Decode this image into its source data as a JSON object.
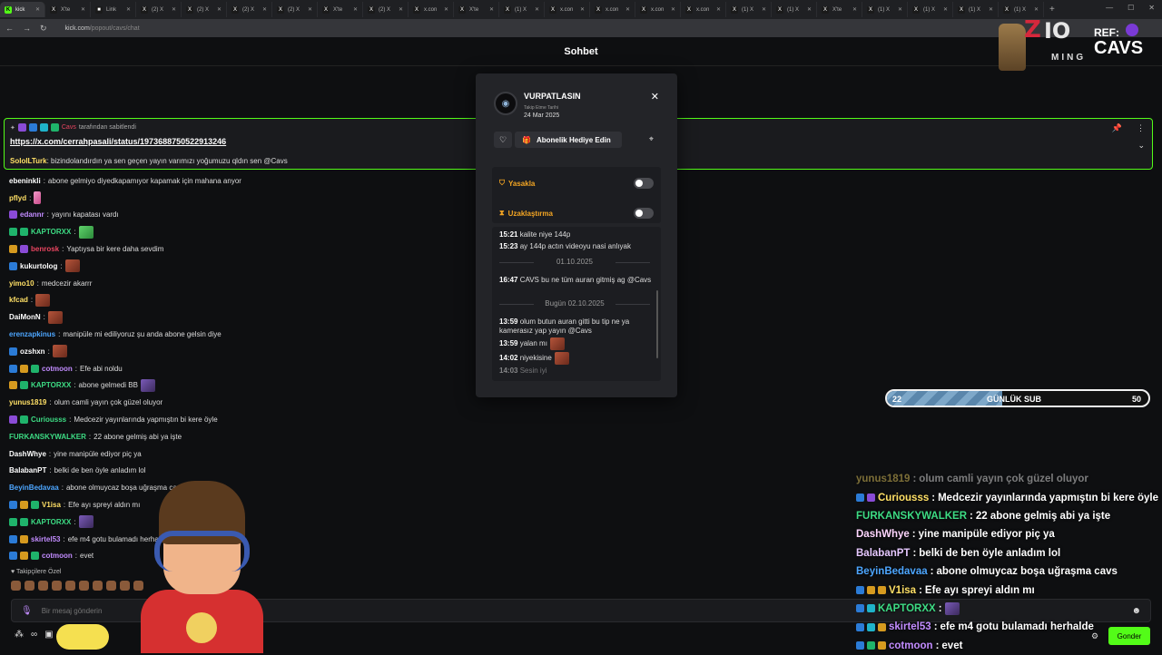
{
  "browser": {
    "tabs": [
      {
        "label": "kick",
        "fav": "K",
        "active": true
      },
      {
        "label": "X'te",
        "fav": "X"
      },
      {
        "label": "Link",
        "fav": "■"
      },
      {
        "label": "(2) X",
        "fav": "X"
      },
      {
        "label": "(2) X",
        "fav": "X"
      },
      {
        "label": "(2) X",
        "fav": "X"
      },
      {
        "label": "(2) X",
        "fav": "X"
      },
      {
        "label": "X'te",
        "fav": "X"
      },
      {
        "label": "(2) X",
        "fav": "X"
      },
      {
        "label": "x.con",
        "fav": "X"
      },
      {
        "label": "X'te",
        "fav": "X"
      },
      {
        "label": "(1) X",
        "fav": "X"
      },
      {
        "label": "x.con",
        "fav": "X"
      },
      {
        "label": "x.con",
        "fav": "X"
      },
      {
        "label": "x.con",
        "fav": "X"
      },
      {
        "label": "x.con",
        "fav": "X"
      },
      {
        "label": "(1) X",
        "fav": "X"
      },
      {
        "label": "(1) X",
        "fav": "X"
      },
      {
        "label": "X'te",
        "fav": "X"
      },
      {
        "label": "(1) X",
        "fav": "X"
      },
      {
        "label": "(1) X",
        "fav": "X"
      },
      {
        "label": "(1) X",
        "fav": "X"
      },
      {
        "label": "(1) X",
        "fav": "X"
      }
    ],
    "url_host": "kick.com",
    "url_path": "/popout/cavs/chat"
  },
  "header": {
    "title": "Sohbet"
  },
  "pinned": {
    "user": "Cavs",
    "by_text": "tarafından sabitlendi",
    "link": "https://x.com/cerrahpasali/status/1973688750522913246",
    "partial_user": "SoloILTurk",
    "partial_text": "bizindolandırdın ya sen geçen yayın varımızı yoğumuzu qldın sen @Cavs"
  },
  "chat": [
    {
      "user": "ebeninkli",
      "color": "#ffffff",
      "badges": [],
      "text": "abone gelmiyo diyedkapamıyor kapamak için mahana anyor"
    },
    {
      "user": "pflyd",
      "color": "#ffe066",
      "badges": [],
      "text": "",
      "emote": "pink"
    },
    {
      "user": "edannr",
      "color": "#c28cff",
      "badges": [
        "purple"
      ],
      "text": "yayını kapatası vardı"
    },
    {
      "user": "KAPTORXX",
      "color": "#3ddc84",
      "badges": [
        "green",
        "green"
      ],
      "text": "",
      "emote": "owl"
    },
    {
      "user": "benrosk",
      "color": "#e94560",
      "badges": [
        "gold",
        "purple"
      ],
      "text": "Yaptıysa bir kere daha sevdim"
    },
    {
      "user": "kukurtolog",
      "color": "#ffffff",
      "badges": [
        "blue"
      ],
      "text": "",
      "emote": "face"
    },
    {
      "user": "yimo10",
      "color": "#ffe066",
      "badges": [],
      "text": "medcezir akarrr"
    },
    {
      "user": "kfcad",
      "color": "#ffe066",
      "badges": [],
      "text": "",
      "emote": "face"
    },
    {
      "user": "DaiMonN",
      "color": "#ffffff",
      "badges": [],
      "text": "",
      "emote": "face"
    },
    {
      "user": "erenzapkinus",
      "color": "#4da6ff",
      "badges": [],
      "text": "manipüle mi ediliyoruz şu anda abone gelsin diye"
    },
    {
      "user": "ozshxn",
      "color": "#ffffff",
      "badges": [
        "gray"
      ],
      "text": "",
      "emote": "face"
    },
    {
      "user": "cotmoon",
      "color": "#c28cff",
      "badges": [
        "blue",
        "gold",
        "green"
      ],
      "text": "Efe abi noldu"
    },
    {
      "user": "KAPTORXX",
      "color": "#3ddc84",
      "badges": [
        "gold",
        "green"
      ],
      "text": "abone gelmedi BB",
      "emote": "purp"
    },
    {
      "user": "yunus1819",
      "color": "#ffe066",
      "badges": [],
      "text": "olum camli yayın çok güzel oluyor"
    },
    {
      "user": "Curiousss",
      "color": "#3ddc84",
      "badges": [
        "purple",
        "green"
      ],
      "text": "Medcezir yayınlarında yapmıştın bi kere öyle"
    },
    {
      "user": "FURKANSKYWALKER",
      "color": "#3ddc84",
      "badges": [],
      "text": "22 abone gelmiş abi ya işte"
    },
    {
      "user": "DashWhye",
      "color": "#ffffff",
      "badges": [],
      "text": "yine manipüle ediyor piç ya"
    },
    {
      "user": "BalabanPT",
      "color": "#ffffff",
      "badges": [],
      "text": "belki de ben öyle anladım lol"
    },
    {
      "user": "BeyinBedavaa",
      "color": "#4da6ff",
      "badges": [],
      "text": "abone olmuycaz boşa uğraşma cavs"
    },
    {
      "user": "V1isa",
      "color": "#ffe066",
      "badges": [
        "blue",
        "gold",
        "green"
      ],
      "text": "Efe ayı spreyi aldın mı"
    },
    {
      "user": "KAPTORXX",
      "color": "#3ddc84",
      "badges": [
        "green",
        "green"
      ],
      "text": "",
      "emote": "purp"
    },
    {
      "user": "skirtel53",
      "color": "#c28cff",
      "badges": [
        "blue",
        "gold"
      ],
      "text": "efe m4 gotu bulamadı herhalde"
    },
    {
      "user": "cotmoon",
      "color": "#c28cff",
      "badges": [
        "blue",
        "gold",
        "green"
      ],
      "text": "evet"
    }
  ],
  "followers_label": "Takipçilere Özel",
  "input": {
    "placeholder": "Bir mesaj gönderin",
    "send_label": "Gonder"
  },
  "modal": {
    "username": "VURPATLASIN",
    "follow_label": "Takip Etme Tarihi",
    "follow_date": "24 Mar 2025",
    "gift_label": "Abonelik Hediye Edin",
    "ban_label": "Yasakla",
    "timeout_label": "Uzaklaştırma",
    "history": [
      {
        "type": "msg",
        "time": "15:21",
        "text": "kalite niye 144p"
      },
      {
        "type": "msg",
        "time": "15:23",
        "text": "ay 144p actın videoyu nasi anlıyak"
      },
      {
        "type": "sep",
        "text": "01.10.2025"
      },
      {
        "type": "msg",
        "time": "16:47",
        "text": "CAVS bu ne tüm auran gitmiş ag @Cavs"
      },
      {
        "type": "sep",
        "text": "Bugün 02.10.2025"
      },
      {
        "type": "msg",
        "time": "13:59",
        "text": "olum butun auran gitti bu tip ne ya kamerasız yap yayın @Cavs"
      },
      {
        "type": "msg",
        "time": "13:59",
        "text": "yalan mı"
      },
      {
        "type": "msg",
        "time": "14:02",
        "text": "niyekisine"
      },
      {
        "type": "msg",
        "time": "14:03",
        "text": "Sesin iyi"
      }
    ]
  },
  "sub_goal": {
    "label": "GÜNLÜK SUB",
    "current": "22",
    "goal": "50",
    "progress": 0.44
  },
  "overlay": [
    {
      "user": "yunus1819",
      "color": "#ffe066",
      "text": "olum camli yayın çok güzel oluyor",
      "faded": true,
      "badges": []
    },
    {
      "user": "Curiousss",
      "color": "#ffe066",
      "text": "Medcezir yayınlarında yapmıştın bi kere öyle",
      "badges": [
        "blue",
        "purple"
      ]
    },
    {
      "user": "FURKANSKYWALKER",
      "color": "#3ddc84",
      "text": "22 abone gelmiş abi ya işte",
      "badges": []
    },
    {
      "user": "DashWhye",
      "color": "#ffd6ff",
      "text": "yine manipüle ediyor piç ya",
      "badges": []
    },
    {
      "user": "BalabanPT",
      "color": "#e6c8ff",
      "text": "belki de ben öyle anladım lol",
      "badges": []
    },
    {
      "user": "BeyinBedavaa",
      "color": "#4da6ff",
      "text": "abone olmuycaz boşa uğraşma cavs",
      "badges": []
    },
    {
      "user": "V1isa",
      "color": "#ffe066",
      "text": "Efe ayı spreyi aldın mı",
      "badges": [
        "blue",
        "gold",
        "gold"
      ]
    },
    {
      "user": "KAPTORXX",
      "color": "#3ddc84",
      "text": "",
      "badges": [
        "blue",
        "cyan"
      ],
      "emote": "purp"
    },
    {
      "user": "skirtel53",
      "color": "#c28cff",
      "text": "efe m4 gotu bulamadı herhalde",
      "badges": [
        "blue",
        "cyan",
        "gold"
      ]
    },
    {
      "user": "cotmoon",
      "color": "#c28cff",
      "text": "evet",
      "badges": [
        "blue",
        "green",
        "gold"
      ]
    }
  ],
  "logo": {
    "z": "Z",
    "io": "IO",
    "ming": "MING",
    "ref": "REF:",
    "name": "CAVS"
  }
}
